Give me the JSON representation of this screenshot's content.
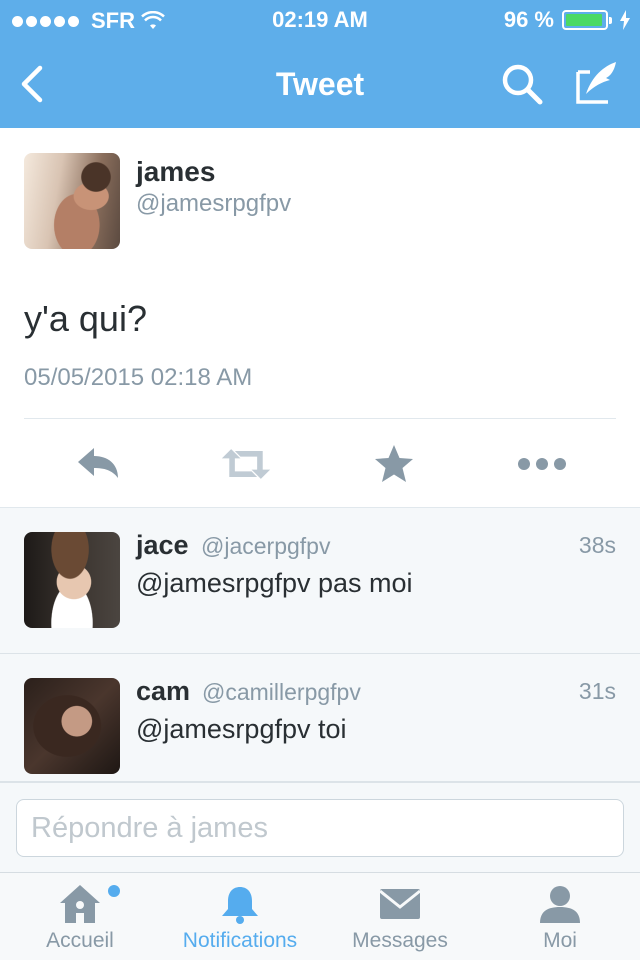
{
  "status_bar": {
    "carrier": "SFR",
    "time": "02:19 AM",
    "battery_percent": "96 %",
    "battery_level": 0.96,
    "signal_bars": 5
  },
  "nav": {
    "title": "Tweet",
    "back_icon": "chevron-left-icon",
    "search_icon": "search-icon",
    "compose_icon": "compose-tweet-icon"
  },
  "tweet": {
    "author_name": "james",
    "author_handle": "@jamesrpgfpv",
    "text": "y'a qui?",
    "timestamp": "05/05/2015 02:18 AM",
    "actions": [
      "reply-icon",
      "retweet-icon",
      "favorite-icon",
      "more-icon"
    ]
  },
  "replies": [
    {
      "name": "jace",
      "handle": "@jacerpgfpv",
      "time": "38s",
      "text": "@jamesrpgfpv pas moi"
    },
    {
      "name": "cam",
      "handle": "@camillerpgfpv",
      "time": "31s",
      "text": "@jamesrpgfpv toi"
    }
  ],
  "composer": {
    "placeholder": "Répondre à james",
    "value": ""
  },
  "tabbar": {
    "items": [
      {
        "label": "Accueil",
        "icon": "home-icon",
        "active": false,
        "badge": true
      },
      {
        "label": "Notifications",
        "icon": "bell-icon",
        "active": true,
        "badge": false
      },
      {
        "label": "Messages",
        "icon": "envelope-icon",
        "active": false,
        "badge": false
      },
      {
        "label": "Moi",
        "icon": "person-icon",
        "active": false,
        "badge": false
      }
    ]
  },
  "colors": {
    "header_blue": "#5eaeea",
    "accent_blue": "#55acee",
    "battery_green": "#4cd964",
    "muted_gray": "#8899a6",
    "text_dark": "#292f33"
  }
}
